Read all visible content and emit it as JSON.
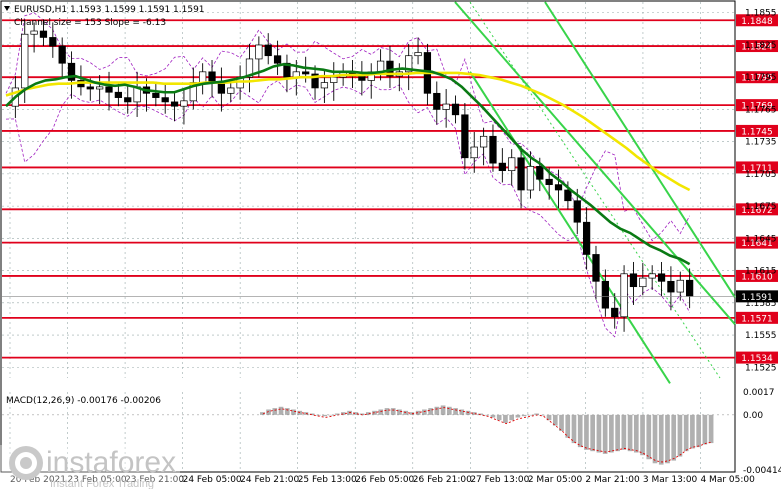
{
  "header": {
    "symbol_line": "EURUSD,H1  1.1593 1.1599 1.1591 1.1591",
    "channel_line": "Channel size = 153 Slope = -6.13"
  },
  "macd": {
    "label": "MACD(12,26,9) -0.00176 -0.00206"
  },
  "watermark": {
    "brand": "instaforex",
    "tagline": "Instant Forex Trading"
  },
  "colors": {
    "level_line": "#e0001b",
    "ma_fast": "#0a7a14",
    "ma_slow": "#f2e600",
    "channel": "#38d44a",
    "bollinger": "#a020c0",
    "current_price_bg": "#000000"
  },
  "chart_data": {
    "type": "line",
    "instrument": "EURUSD",
    "timeframe": "H1",
    "ylim": [
      1.1515,
      1.1865
    ],
    "y_ticks": [
      1.1855,
      1.1825,
      1.1795,
      1.1765,
      1.1735,
      1.1705,
      1.1675,
      1.1645,
      1.1615,
      1.1585,
      1.1555,
      1.1525
    ],
    "levels": [
      1.1848,
      1.1824,
      1.1795,
      1.1769,
      1.1745,
      1.1711,
      1.1672,
      1.1641,
      1.161,
      1.1571,
      1.1534
    ],
    "current_price": 1.1591,
    "x_ticks": [
      "20 Feb 2021",
      "23 Feb 05:00",
      "23 Feb 21:00",
      "24 Feb 05:00",
      "24 Feb 21:00",
      "25 Feb 13:00",
      "26 Feb 05:00",
      "26 Feb 21:00",
      "27 Feb 13:00",
      "2 Mar 05:00",
      "2 Mar 21:00",
      "3 Mar 13:00",
      "4 Mar 05:00"
    ],
    "series": [
      {
        "values": [
          1.1768,
          1.1785,
          1.1835,
          1.1838,
          1.1832,
          1.1824,
          1.1808,
          1.1792,
          1.1786,
          1.1784,
          1.1786,
          1.1781,
          1.1776,
          1.1772,
          1.1786,
          1.178,
          1.1776,
          1.1772,
          1.1768,
          1.1773,
          1.179,
          1.18,
          1.179,
          1.178,
          1.1785,
          1.1795,
          1.1812,
          1.1825,
          1.1815,
          1.1808,
          1.1795,
          1.18,
          1.1798,
          1.1785,
          1.179,
          1.1795,
          1.18,
          1.1796,
          1.1792,
          1.18,
          1.181,
          1.1796,
          1.18,
          1.1815,
          1.1818,
          1.178,
          1.1765,
          1.177,
          1.176,
          1.172,
          1.173,
          1.174,
          1.1715,
          1.1708,
          1.172,
          1.169,
          1.1712,
          1.17,
          1.1695,
          1.169,
          1.168,
          1.166,
          1.163,
          1.1605,
          1.158,
          1.1572,
          1.1612,
          1.16,
          1.1608,
          1.1612,
          1.1605,
          1.1595,
          1.1606,
          1.1591
        ]
      },
      {
        "values": [
          1.1768,
          1.1777,
          1.1784,
          1.1789,
          1.1792,
          1.1793,
          1.1795,
          1.1796,
          1.1793,
          1.179,
          1.1788,
          1.1787,
          1.1788,
          1.1786,
          1.1783,
          1.1782,
          1.1781,
          1.1781,
          1.1784,
          1.1787,
          1.1789,
          1.179,
          1.1791,
          1.1793,
          1.1795,
          1.1798,
          1.1801,
          1.1805,
          1.1807,
          1.1806,
          1.1804,
          1.1803,
          1.1802,
          1.18,
          1.18,
          1.18,
          1.1799,
          1.1799,
          1.18,
          1.1802,
          1.1803,
          1.1802,
          1.1801,
          1.18,
          1.1797,
          1.1793,
          1.1786,
          1.1777,
          1.1768,
          1.1758,
          1.1748,
          1.1738,
          1.1728,
          1.172,
          1.1714,
          1.1705,
          1.1698,
          1.169,
          1.1683,
          1.1676,
          1.1668,
          1.166,
          1.1654,
          1.165,
          1.1644,
          1.1638,
          1.1634,
          1.1629,
          1.1626,
          1.1621
        ]
      },
      {
        "values": [
          1.1778,
          1.1781,
          1.1784,
          1.1786,
          1.1788,
          1.1789,
          1.1789,
          1.179,
          1.179,
          1.179,
          1.179,
          1.179,
          1.179,
          1.179,
          1.179,
          1.1789,
          1.1789,
          1.1789,
          1.1789,
          1.179,
          1.179,
          1.179,
          1.1791,
          1.1791,
          1.1792,
          1.1793,
          1.1793,
          1.1794,
          1.1795,
          1.1795,
          1.1796,
          1.1796,
          1.1797,
          1.1797,
          1.1797,
          1.1798,
          1.1798,
          1.1798,
          1.1798,
          1.1799,
          1.1799,
          1.1799,
          1.1799,
          1.1799,
          1.1798,
          1.1797,
          1.1795,
          1.1793,
          1.179,
          1.1787,
          1.1783,
          1.1779,
          1.1774,
          1.1769,
          1.1763,
          1.1757,
          1.175,
          1.1743,
          1.1736,
          1.1729,
          1.1721,
          1.1714,
          1.1707,
          1.1701,
          1.1695,
          1.169
        ]
      }
    ],
    "macd_ylim": [
      -0.00041,
      0.00017
    ],
    "macd_ticks": [
      "0.0017",
      "0.00",
      "-0.00414"
    ],
    "macd_hist": [
      2e-05,
      4e-05,
      5e-05,
      6e-05,
      5e-05,
      4e-05,
      3e-05,
      2e-05,
      1e-05,
      0.0,
      -1e-05,
      0.0,
      1e-05,
      2e-05,
      3e-05,
      2e-05,
      1e-05,
      2e-05,
      3e-05,
      4e-05,
      5e-05,
      5e-05,
      4e-05,
      3e-05,
      2e-05,
      3e-05,
      4e-05,
      5e-05,
      6e-05,
      7e-05,
      6e-05,
      5e-05,
      4e-05,
      3e-05,
      2e-05,
      1e-05,
      0.0,
      -2e-05,
      -4e-05,
      -6e-05,
      -4e-05,
      -2e-05,
      -1e-05,
      0.0,
      1e-05,
      0.0,
      -4e-05,
      -8e-05,
      -0.00012,
      -0.00017,
      -0.00021,
      -0.00024,
      -0.00026,
      -0.00027,
      -0.00028,
      -0.00029,
      -0.00028,
      -0.00027,
      -0.00026,
      -0.00027,
      -0.00028,
      -0.0003,
      -0.00033,
      -0.00036,
      -0.00037,
      -0.00036,
      -0.00034,
      -0.00031,
      -0.00027,
      -0.00025,
      -0.00024,
      -0.00022,
      -0.00021
    ]
  }
}
